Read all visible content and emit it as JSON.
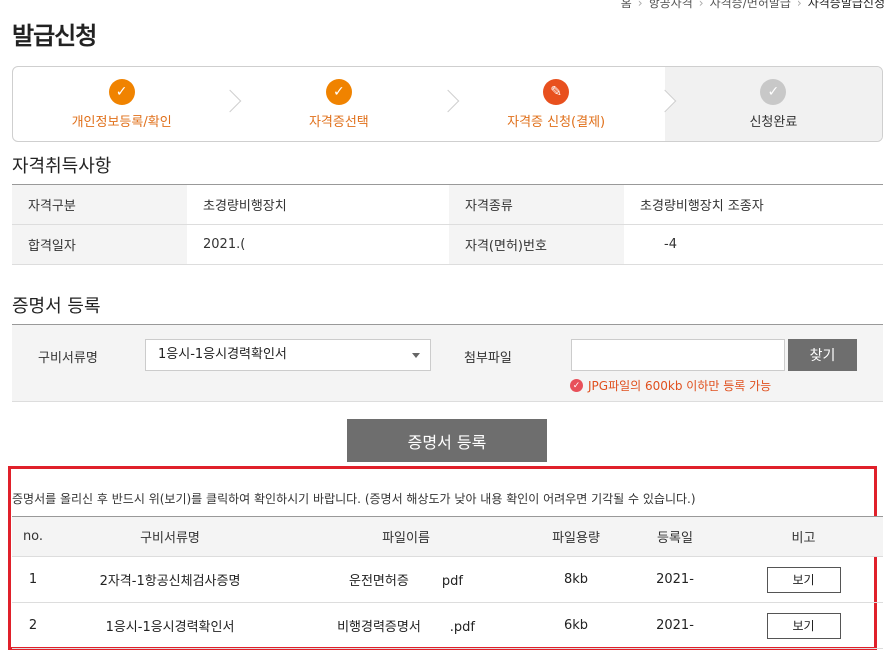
{
  "breadcrumb": [
    "홈",
    "항공자격",
    "자격증/면허발급",
    "자격증발급신청"
  ],
  "page_title": "발급신청",
  "steps": [
    {
      "label": "개인정보등록/확인",
      "state": "done",
      "icon": "check-icon"
    },
    {
      "label": "자격증선택",
      "state": "done",
      "icon": "check-icon"
    },
    {
      "label": "자격증 신청(결제)",
      "state": "active",
      "icon": "pencil-icon"
    },
    {
      "label": "신청완료",
      "state": "pending",
      "icon": "check-icon"
    }
  ],
  "qualification": {
    "title": "자격취득사항",
    "rows": [
      {
        "k1": "자격구분",
        "v1": "초경량비행장치",
        "k2": "자격종류",
        "v2": "초경량비행장치 조종자"
      },
      {
        "k1": "합격일자",
        "v1": "2021.(",
        "k2": "자격(면허)번호",
        "v2": "-4"
      }
    ]
  },
  "certificate": {
    "title": "증명서 등록",
    "doc_label": "구비서류명",
    "doc_selected": "1응시-1응시경력확인서",
    "file_label": "첨부파일",
    "file_value": "",
    "find_button": "찾기",
    "hint": "JPG파일의 600kb 이하만 등록 가능",
    "register_button": "증명서 등록"
  },
  "notice": "증명서를 올리신 후 반드시 위(보기)를 클릭하여 확인하시기 바랍니다. (증명서 해상도가 낮아 내용 확인이 어려우면 기각될 수 있습니다.)",
  "files_table": {
    "headers": [
      "no.",
      "구비서류명",
      "파일이름",
      "파일용량",
      "등록일",
      "비고"
    ],
    "rows": [
      {
        "no": "1",
        "doc": "2자격-1항공신체검사증명",
        "filename": "운전면허증        pdf",
        "size": "8kb",
        "date": "2021-",
        "action": "보기"
      },
      {
        "no": "2",
        "doc": "1응시-1응시경력확인서",
        "filename": "비행경력증명서       .pdf",
        "size": "6kb",
        "date": "2021-",
        "action": "보기"
      }
    ]
  },
  "colors": {
    "accent_orange": "#f08300",
    "active_orange": "#e8501e",
    "frame_red": "#e0202a",
    "button_gray": "#6e6e6e"
  }
}
